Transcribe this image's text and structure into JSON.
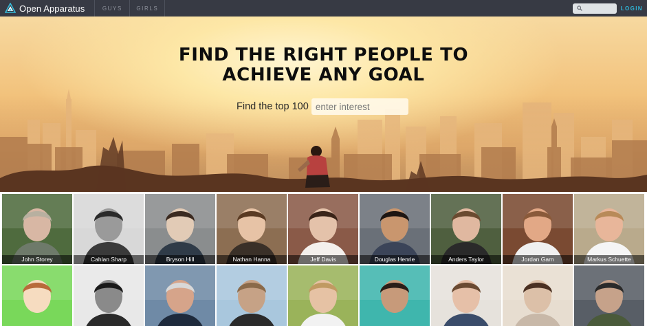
{
  "navbar": {
    "brand": "Open Apparatus",
    "links": [
      "GUYS",
      "GIRLS"
    ],
    "search_placeholder": "",
    "login_label": "LOGIN"
  },
  "hero": {
    "title_line1": "FIND THE RIGHT PEOPLE TO",
    "title_line2": "ACHIEVE ANY GOAL",
    "prompt_label": "Find the top 100",
    "input_placeholder": "enter interest"
  },
  "people_row1": [
    {
      "name": "John Storey",
      "bg": "#4f6b3e",
      "skin": "#d8b7a4",
      "hair": "#b8b0a0",
      "shirt": "#6e7a6a",
      "gray": false
    },
    {
      "name": "Cahlan Sharp",
      "bg": "#d8d8d8",
      "skin": "#9a9a9a",
      "hair": "#2a2a2a",
      "shirt": "#3a3a3a",
      "gray": true
    },
    {
      "name": "Bryson Hill",
      "bg": "#8a8d8e",
      "skin": "#e2cbb6",
      "hair": "#3b2a20",
      "shirt": "#2f3b48",
      "gray": false
    },
    {
      "name": "Nathan Hanna",
      "bg": "#8c6e52",
      "skin": "#e7c3a6",
      "hair": "#5a3a22",
      "shirt": "#3a3028",
      "gray": false
    },
    {
      "name": "Jeff Davis",
      "bg": "#8a5a48",
      "skin": "#e4c2aa",
      "hair": "#3a2418",
      "shirt": "#f4f0ec",
      "gray": false
    },
    {
      "name": "Douglas Henrie",
      "bg": "#6a7078",
      "skin": "#c9966e",
      "hair": "#1e1612",
      "shirt": "#3b4458",
      "gray": false
    },
    {
      "name": "Anders Taylor",
      "bg": "#4f5f3f",
      "skin": "#e0b8a0",
      "hair": "#6a4a30",
      "shirt": "#2a2a2a",
      "gray": false
    },
    {
      "name": "Jordan Garn",
      "bg": "#7a4a32",
      "skin": "#e2a886",
      "hair": "#8a5a3a",
      "shirt": "#f0f0f0",
      "gray": false
    },
    {
      "name": "Markus Schuette",
      "bg": "#b9aa8c",
      "skin": "#e8b69a",
      "hair": "#b88a58",
      "shirt": "#f5f5f5",
      "gray": false
    }
  ],
  "people_row2": [
    {
      "bg": "#79d85a",
      "skin": "#f6dcc0",
      "hair": "#b86a3a",
      "shirt": "#79d85a",
      "gray": false
    },
    {
      "bg": "#e8e8e8",
      "skin": "#8a8a8a",
      "hair": "#1a1a1a",
      "shirt": "#2a2a2a",
      "gray": true
    },
    {
      "bg": "#6f8aa6",
      "skin": "#d6a48a",
      "hair": "#d8d8d8",
      "shirt": "#1e2a3c",
      "gray": false
    },
    {
      "bg": "#a9c7dd",
      "skin": "#c6a286",
      "hair": "#8a6a4a",
      "shirt": "#2a2a2a",
      "gray": false
    },
    {
      "bg": "#9ab35a",
      "skin": "#e6c2a4",
      "hair": "#c09a62",
      "shirt": "#f2f2f2",
      "gray": false
    },
    {
      "bg": "#3fb6ad",
      "skin": "#c79a7a",
      "hair": "#2a1e18",
      "shirt": "#3fb6ad",
      "gray": false
    },
    {
      "bg": "#e6e2dc",
      "skin": "#e6c0a8",
      "hair": "#6a4a32",
      "shirt": "#3a4c6a",
      "gray": false
    },
    {
      "bg": "#e7ddd0",
      "skin": "#dcc0a8",
      "hair": "#4a3022",
      "shirt": "#c8b8a8",
      "gray": false
    },
    {
      "bg": "#585e66",
      "skin": "#c6a28a",
      "hair": "#2a2a2a",
      "shirt": "#4a5a3a",
      "gray": false
    }
  ]
}
